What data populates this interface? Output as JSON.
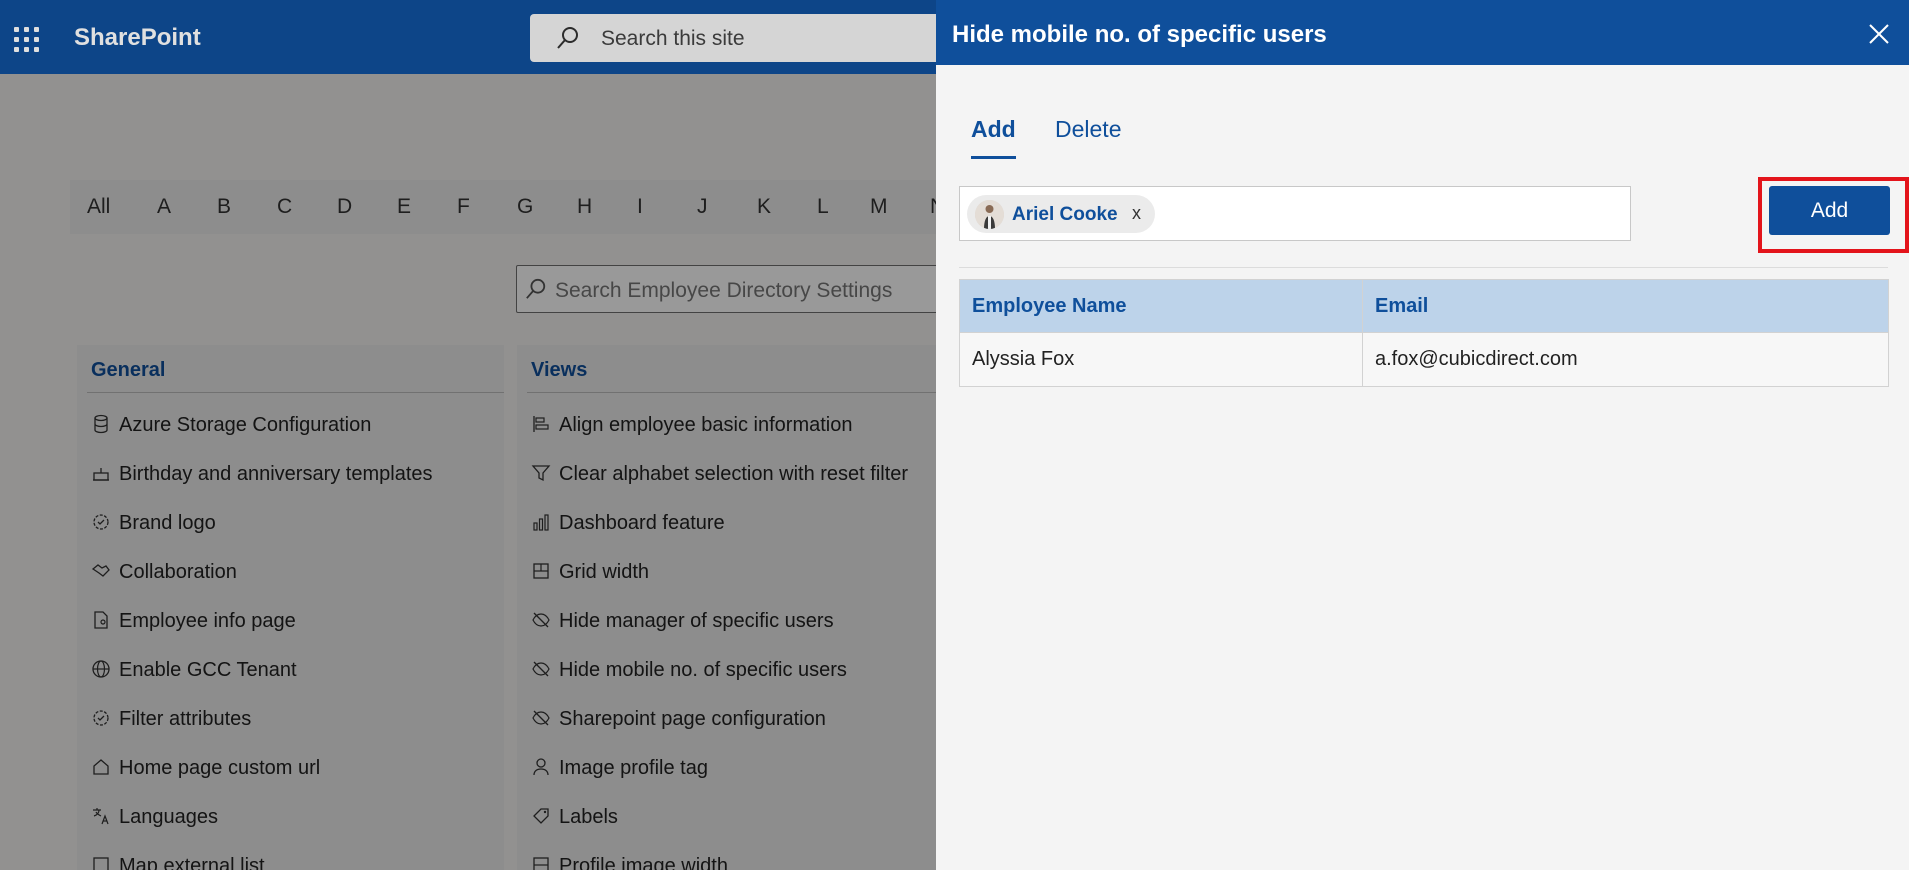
{
  "header": {
    "brand": "SharePoint",
    "search_placeholder": "Search this site"
  },
  "alphabet": [
    "All",
    "A",
    "B",
    "C",
    "D",
    "E",
    "F",
    "G",
    "H",
    "I",
    "J",
    "K",
    "L",
    "M",
    "N"
  ],
  "settings_search_placeholder": "Search Employee Directory Settings",
  "general": {
    "heading": "General",
    "items": [
      {
        "label": "Azure Storage Configuration",
        "icon": "database-icon"
      },
      {
        "label": "Birthday and anniversary templates",
        "icon": "cake-icon"
      },
      {
        "label": "Brand logo",
        "icon": "badge-icon"
      },
      {
        "label": "Collaboration",
        "icon": "handshake-icon"
      },
      {
        "label": "Employee info page",
        "icon": "contact-page-icon"
      },
      {
        "label": "Enable GCC Tenant",
        "icon": "globe-icon"
      },
      {
        "label": "Filter attributes",
        "icon": "badge-icon"
      },
      {
        "label": "Home page custom url",
        "icon": "home-icon"
      },
      {
        "label": "Languages",
        "icon": "translate-icon"
      },
      {
        "label": "Map external list",
        "icon": "list-icon"
      }
    ]
  },
  "views": {
    "heading": "Views",
    "items": [
      {
        "label": "Align employee basic information",
        "icon": "align-icon"
      },
      {
        "label": "Clear alphabet selection with reset filter",
        "icon": "filter-icon"
      },
      {
        "label": "Dashboard feature",
        "icon": "chart-icon"
      },
      {
        "label": "Grid width",
        "icon": "grid-icon"
      },
      {
        "label": "Hide manager of specific users",
        "icon": "hide-icon"
      },
      {
        "label": "Hide mobile no. of specific users",
        "icon": "hide-icon"
      },
      {
        "label": "Sharepoint page configuration",
        "icon": "hide-icon"
      },
      {
        "label": "Image profile tag",
        "icon": "person-icon"
      },
      {
        "label": "Labels",
        "icon": "tag-icon"
      },
      {
        "label": "Profile image width",
        "icon": "grid-icon"
      }
    ]
  },
  "panel": {
    "title": "Hide mobile no. of specific users",
    "tabs": {
      "add": "Add",
      "delete": "Delete"
    },
    "selected_user": "Ariel Cooke",
    "chip_remove": "x",
    "add_button": "Add",
    "table": {
      "headers": {
        "name": "Employee Name",
        "email": "Email"
      },
      "rows": [
        {
          "name": "Alyssia Fox",
          "email": "a.fox@cubicdirect.com"
        }
      ]
    }
  },
  "colors": {
    "brand_blue": "#0f4f9b",
    "highlight_red": "#e3141b",
    "table_header": "#bdd3ea"
  }
}
